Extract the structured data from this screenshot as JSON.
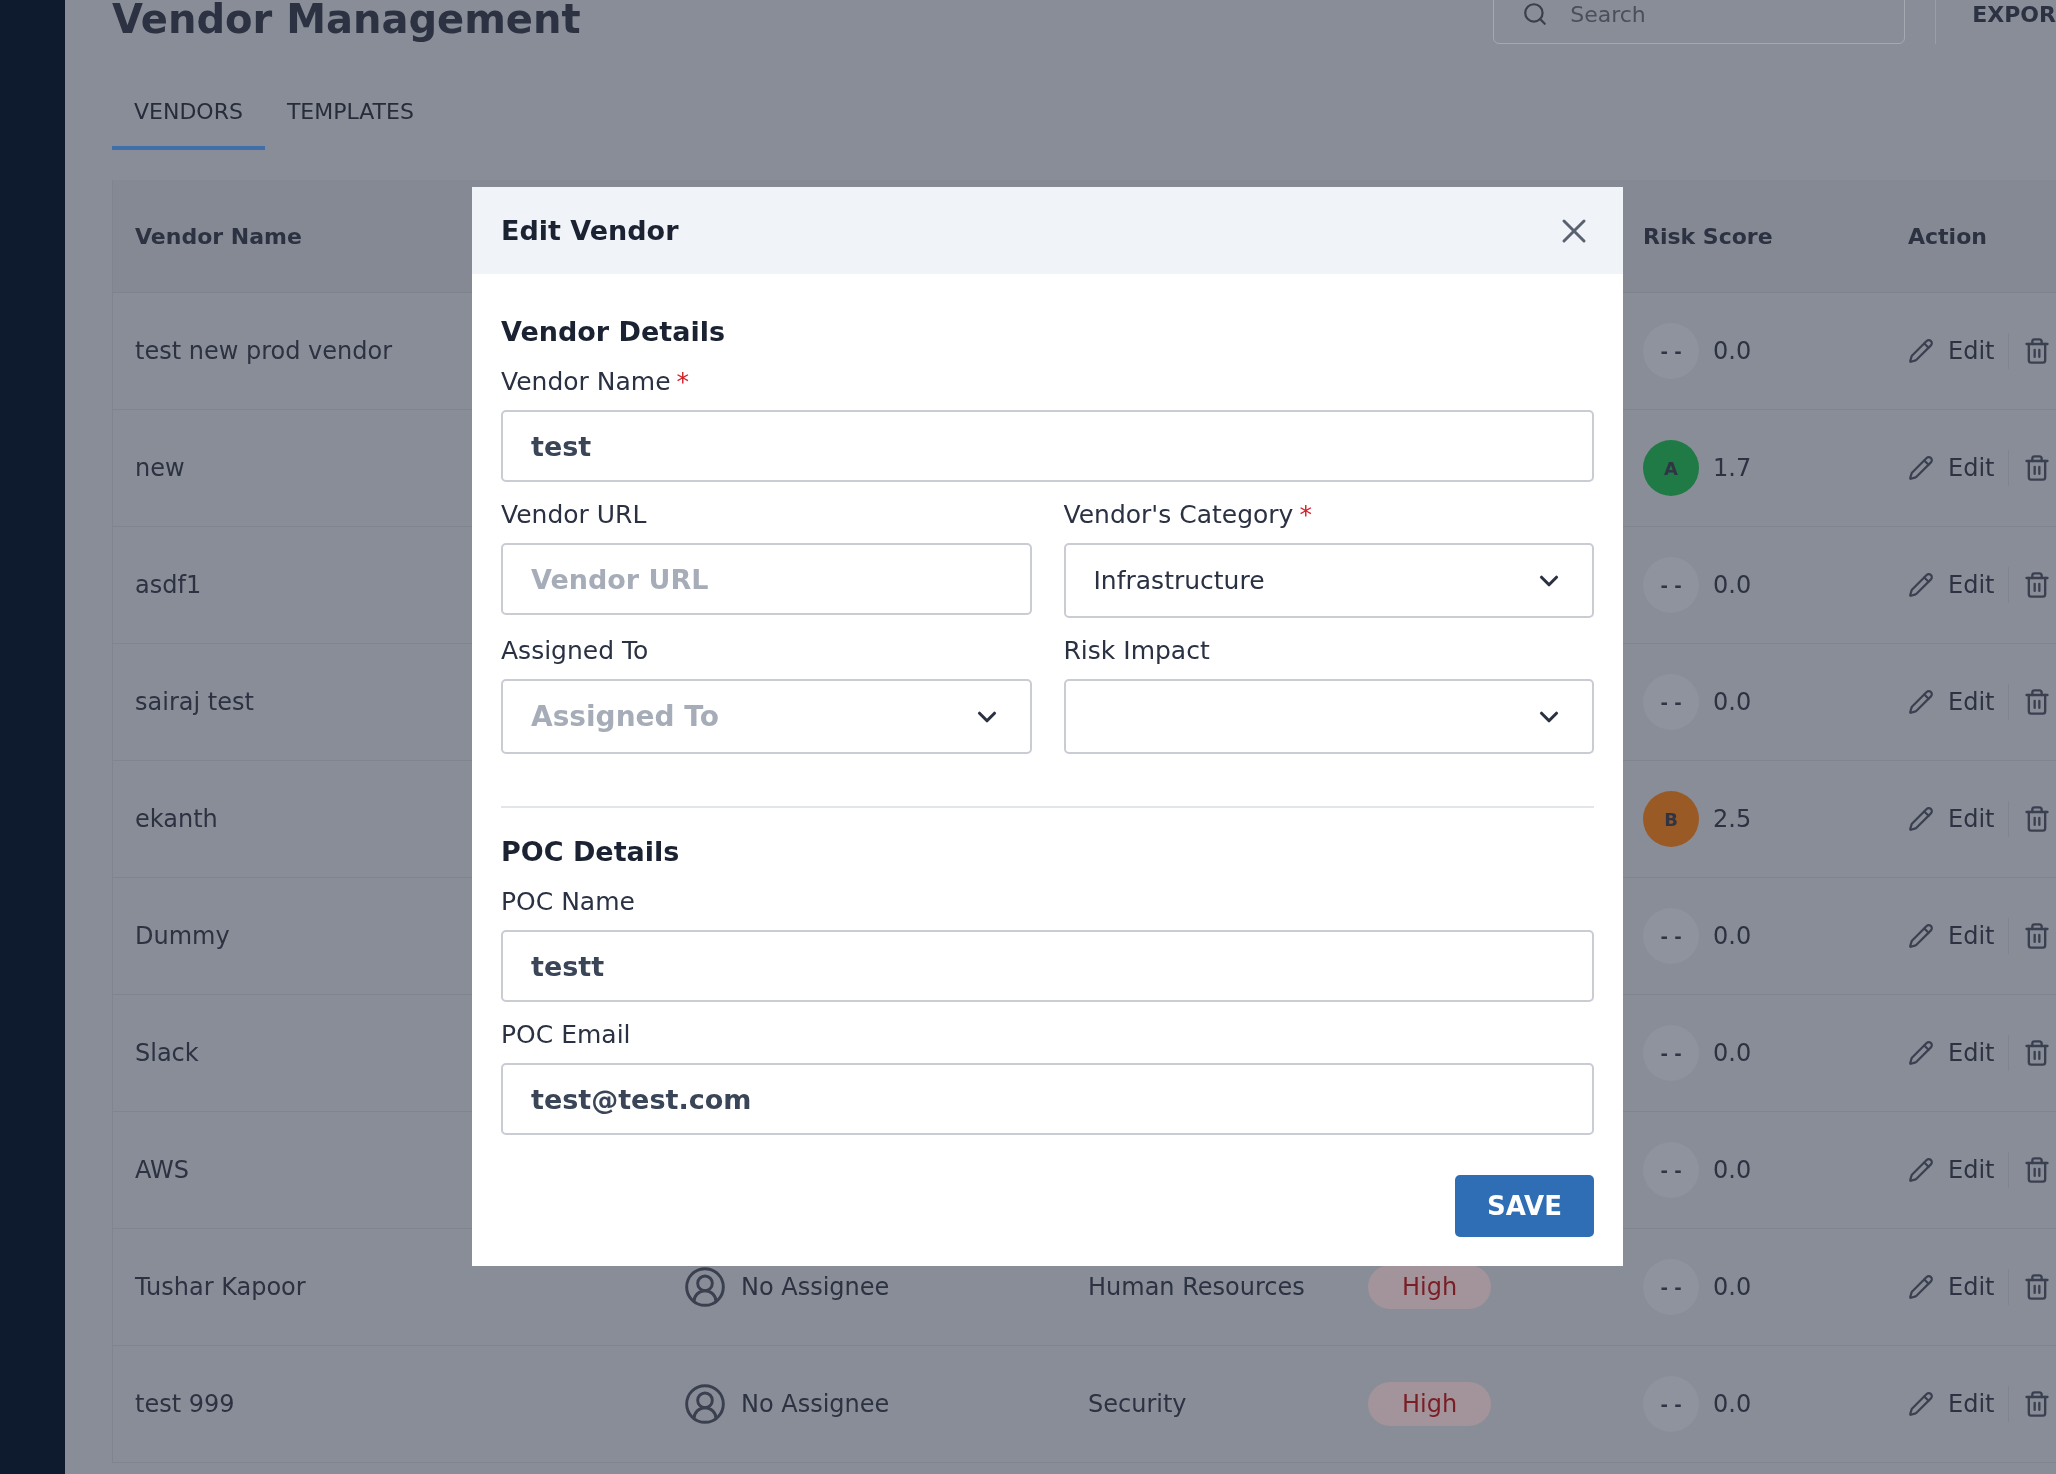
{
  "page": {
    "title": "Vendor Management",
    "search": {
      "placeholder": "Search"
    },
    "export_button": "EXPOR"
  },
  "tabs": [
    {
      "label": "VENDORS",
      "selected": true
    },
    {
      "label": "TEMPLATES",
      "selected": false
    }
  ],
  "table": {
    "columns": {
      "name": "Vendor Name",
      "score": "Risk Score",
      "action": "Action"
    },
    "rows": [
      {
        "name": "test new prod vendor",
        "grade": "- -",
        "color": "#8f939d",
        "score": "0.0",
        "action": "Edit"
      },
      {
        "name": "new",
        "grade": "A",
        "color": "#1f7a45",
        "score": "1.7",
        "action": "Edit"
      },
      {
        "name": "asdf1",
        "grade": "- -",
        "color": "#8f939d",
        "score": "0.0",
        "action": "Edit"
      },
      {
        "name": "sairaj test",
        "grade": "- -",
        "color": "#8f939d",
        "score": "0.0",
        "action": "Edit"
      },
      {
        "name": "ekanth",
        "grade": "B",
        "color": "#9a5a26",
        "score": "2.5",
        "action": "Edit"
      },
      {
        "name": "Dummy",
        "grade": "- -",
        "color": "#8f939d",
        "score": "0.0",
        "action": "Edit"
      },
      {
        "name": "Slack",
        "grade": "- -",
        "color": "#8f939d",
        "score": "0.0",
        "action": "Edit"
      },
      {
        "name": "AWS",
        "grade": "- -",
        "color": "#8f939d",
        "score": "0.0",
        "action": "Edit"
      },
      {
        "name": "Tushar Kapoor",
        "assignee": "No Assignee",
        "category": "Human Resources",
        "impact": "High",
        "grade": "- -",
        "color": "#8f939d",
        "score": "0.0",
        "action": "Edit"
      },
      {
        "name": "test 999",
        "assignee": "No Assignee",
        "category": "Security",
        "impact": "High",
        "grade": "- -",
        "color": "#8f939d",
        "score": "0.0",
        "action": "Edit"
      }
    ]
  },
  "dialog": {
    "title": "Edit Vendor",
    "sections": [
      {
        "heading": "Vendor Details",
        "rows": [
          [
            {
              "label": "Vendor Name",
              "required_mark": "*",
              "kind": "text",
              "value": "test"
            }
          ],
          [
            {
              "label": "Vendor URL",
              "kind": "text",
              "placeholder": "Vendor URL"
            },
            {
              "label": "Vendor's Category",
              "required_mark": "*",
              "kind": "select",
              "value": "Infrastructure"
            }
          ],
          [
            {
              "label": "Assigned To",
              "kind": "select",
              "placeholder": "Assigned To"
            },
            {
              "label": "Risk Impact",
              "kind": "select"
            }
          ]
        ]
      },
      {
        "heading": "POC Details",
        "rows": [
          [
            {
              "label": "POC Name",
              "kind": "text",
              "value": "testt"
            }
          ],
          [
            {
              "label": "POC Email",
              "kind": "text",
              "value": "test@test.com"
            }
          ]
        ]
      }
    ],
    "save_button": "SAVE"
  }
}
